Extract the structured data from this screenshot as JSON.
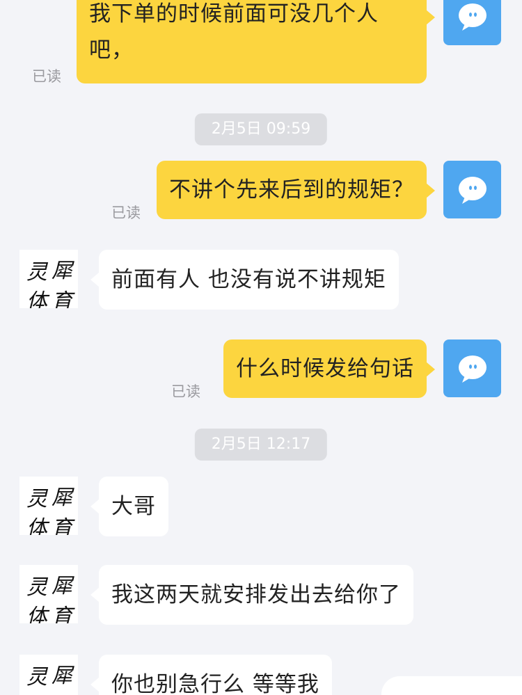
{
  "messages": {
    "m1": {
      "text_line1": "我下单的时候前面可没几个人",
      "text_line2": "吧，",
      "read": "已读"
    },
    "t1": "2月5日 09:59",
    "m2": {
      "text": "不讲个先来后到的规矩？",
      "read": "已读"
    },
    "m3": {
      "text": "前面有人 也没有说不讲规矩"
    },
    "m4": {
      "text": "什么时候发给句话",
      "read": "已读"
    },
    "t2": "2月5日 12:17",
    "m5": {
      "text": "大哥"
    },
    "m6": {
      "text": "我这两天就安排发出去给你了"
    },
    "m7": {
      "text": "你也别急行么 等等我"
    }
  },
  "contact_avatar": {
    "glyphs": [
      "灵",
      "犀",
      "体",
      "育"
    ]
  },
  "colors": {
    "outgoing_bubble": "#fcd53f",
    "incoming_bubble": "#ffffff",
    "self_avatar": "#4fa7f0",
    "background": "#f3f4f8"
  },
  "icons": {
    "self_avatar": "speech-bubble-face-icon"
  }
}
